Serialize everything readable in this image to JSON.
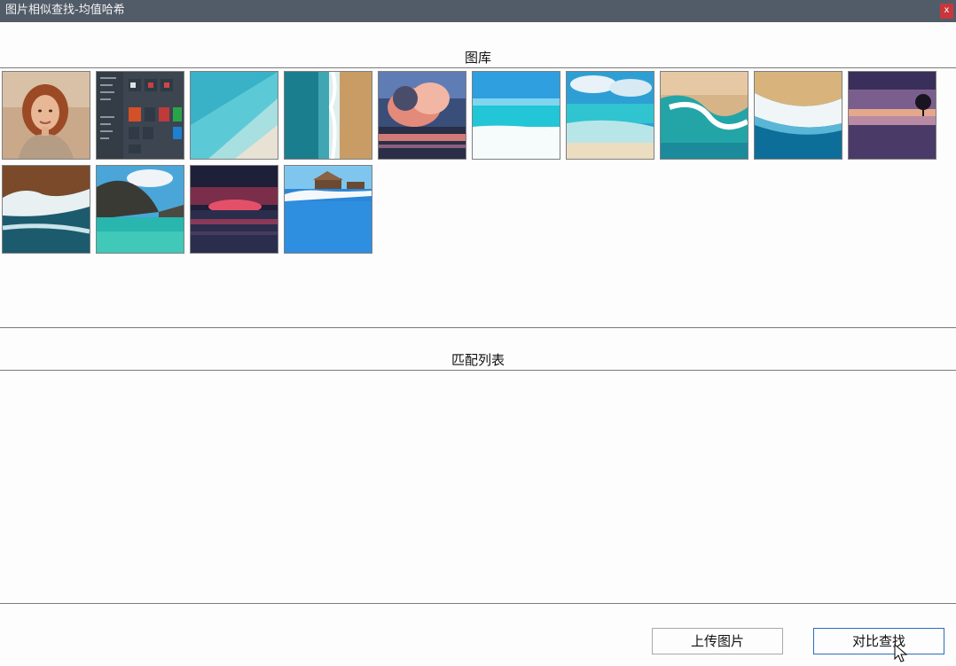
{
  "window": {
    "title": "图片相似查找-均值哈希",
    "close_label": "x"
  },
  "gallery": {
    "header": "图库",
    "images": [
      {
        "name": "portrait-woman"
      },
      {
        "name": "windows-start-menu"
      },
      {
        "name": "turquoise-coast-aerial"
      },
      {
        "name": "beach-waves-aerial"
      },
      {
        "name": "sunset-clouds-lake"
      },
      {
        "name": "tropical-beach-bright"
      },
      {
        "name": "beach-shore-clouds"
      },
      {
        "name": "ocean-wave-curl"
      },
      {
        "name": "wave-foam-aerial"
      },
      {
        "name": "purple-sunset-tree"
      },
      {
        "name": "rocky-coast-waves"
      },
      {
        "name": "lagoon-cliffs"
      },
      {
        "name": "red-sunset-sea"
      },
      {
        "name": "overwater-bungalows-pool"
      }
    ]
  },
  "matches": {
    "header": "匹配列表"
  },
  "actions": {
    "upload_label": "上传图片",
    "compare_label": "对比查找"
  }
}
